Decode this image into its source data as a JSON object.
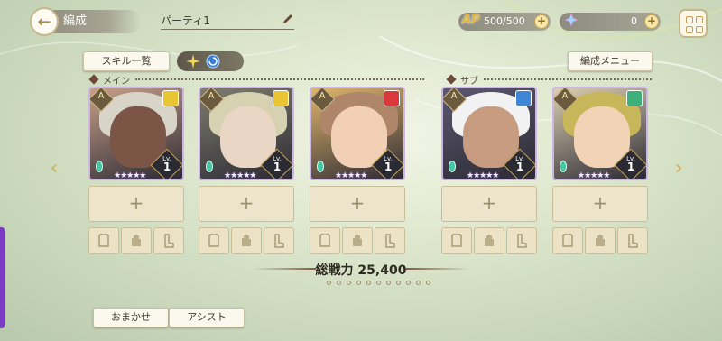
{
  "header": {
    "back_label": "編成",
    "party_name": "パーティ1",
    "ap_label": "AP",
    "ap_value": "500/500",
    "crystal_value": "0"
  },
  "toolbar": {
    "skill_list_label": "スキル一覧",
    "party_menu_label": "編成メニュー"
  },
  "sections": {
    "main_label": "メイン",
    "sub_label": "サブ"
  },
  "cards": [
    {
      "role": "A",
      "level_label": "Lv.",
      "level": "1",
      "stars": "★★★★★",
      "element": "yellow",
      "element_color": "#e9c534",
      "bg": "#c8a089",
      "hair": "#d9d4c8",
      "face": "#7b5545"
    },
    {
      "role": "A",
      "level_label": "Lv.",
      "level": "1",
      "stars": "★★★★★",
      "element": "yellow",
      "element_color": "#e9c534",
      "bg": "#7f7d6e",
      "hair": "#d6d1b0",
      "face": "#e9d6c4"
    },
    {
      "role": "A",
      "level_label": "Lv.",
      "level": "1",
      "stars": "★★★★★",
      "element": "red",
      "element_color": "#d9393b",
      "bg": "#e0b56b",
      "hair": "#b0866a",
      "face": "#f2d0b6"
    },
    {
      "role": "A",
      "level_label": "Lv.",
      "level": "1",
      "stars": "★★★★★",
      "element": "blue",
      "element_color": "#3f86d6",
      "bg": "#5b5870",
      "hair": "#f2f2f2",
      "face": "#c79b80"
    },
    {
      "role": "A",
      "level_label": "Lv.",
      "level": "1",
      "stars": "★★★★★",
      "element": "green",
      "element_color": "#3fb07a",
      "bg": "#dccfb2",
      "hair": "#c8b65a",
      "face": "#f3d3b6"
    }
  ],
  "equip_plus": "+",
  "total_power": "総戦力 25,400",
  "bottom": {
    "auto_label": "おまかせ",
    "assist_label": "アシスト"
  }
}
